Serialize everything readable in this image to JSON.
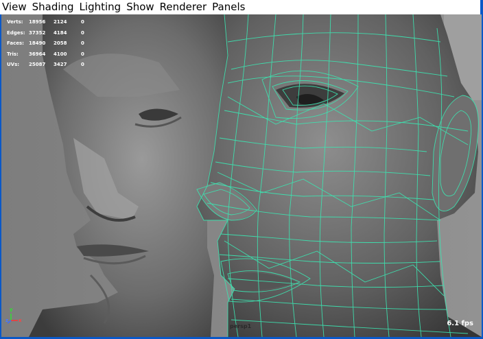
{
  "menubar": {
    "items": [
      "View",
      "Shading",
      "Lighting",
      "Show",
      "Renderer",
      "Panels"
    ]
  },
  "hud": {
    "rows": [
      {
        "label": "Verts:",
        "v1": "18956",
        "v2": "2124",
        "v3": "0"
      },
      {
        "label": "Edges:",
        "v1": "37352",
        "v2": "4184",
        "v3": "0"
      },
      {
        "label": "Faces:",
        "v1": "18490",
        "v2": "2058",
        "v3": "0"
      },
      {
        "label": "Tris:",
        "v1": "36964",
        "v2": "4100",
        "v3": "0"
      },
      {
        "label": "UVs:",
        "v1": "25087",
        "v3": "0",
        "v2": "3427"
      }
    ]
  },
  "viewport": {
    "camera": "persp1",
    "fps": "6.1 fps",
    "axis": {
      "x": "x",
      "y": "y",
      "z": "z"
    }
  },
  "colors": {
    "frame": "#0a58c7",
    "background": "#8a8a8a",
    "wireframe": "#3de3b0"
  },
  "icons": [
    "axis-gizmo-icon"
  ]
}
